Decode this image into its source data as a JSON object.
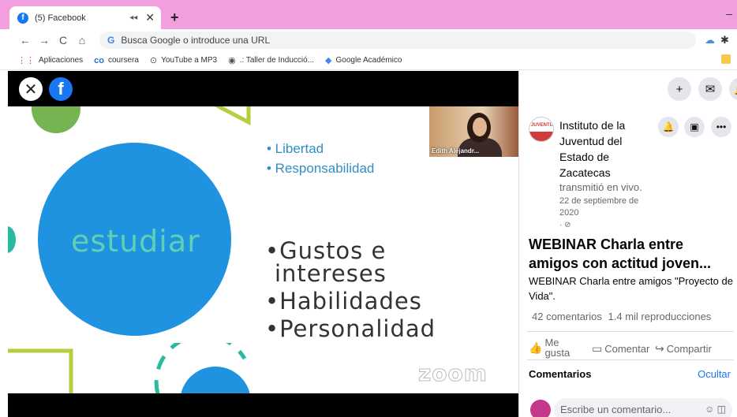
{
  "browser": {
    "tab_title": "(5) Facebook",
    "omnibox_placeholder": "Busca Google o introduce una URL",
    "bookmarks": [
      {
        "icon": "apps-grid-icon",
        "label": "Aplicaciones"
      },
      {
        "icon": "coursera-icon",
        "label": "coursera"
      },
      {
        "icon": "download-icon",
        "label": "YouTube a MP3"
      },
      {
        "icon": "globe-icon",
        "label": ".: Taller de Inducció..."
      },
      {
        "icon": "scholar-icon",
        "label": "Google Académico"
      }
    ]
  },
  "slide": {
    "center_word": "estudiar",
    "small_items": [
      "• Libertad",
      "• Responsabilidad"
    ],
    "big_items": [
      "•Gustos e",
      "intereses",
      "•Habilidades",
      "•Personalidad"
    ],
    "watermark": "zoom",
    "webcam_name": "Edith Alejandr..."
  },
  "post": {
    "page_name": "Instituto de la Juventud del Estado de Zacatecas",
    "action": "transmitió en vivo.",
    "date": "22 de septiembre de 2020",
    "title": "WEBINAR Charla entre amigos con actitud joven...",
    "description": "WEBINAR Charla entre amigos \"Proyecto de Vida\".",
    "comments_count": "42 comentarios",
    "views_count": "1.4 mil reproducciones",
    "like_label_1": "Me",
    "like_label_2": "gusta",
    "comment_label": "Comentar",
    "share_label": "Compartir",
    "comments_heading": "Comentarios",
    "hide_label": "Ocultar",
    "comment_placeholder": "Escribe un comentario..."
  }
}
